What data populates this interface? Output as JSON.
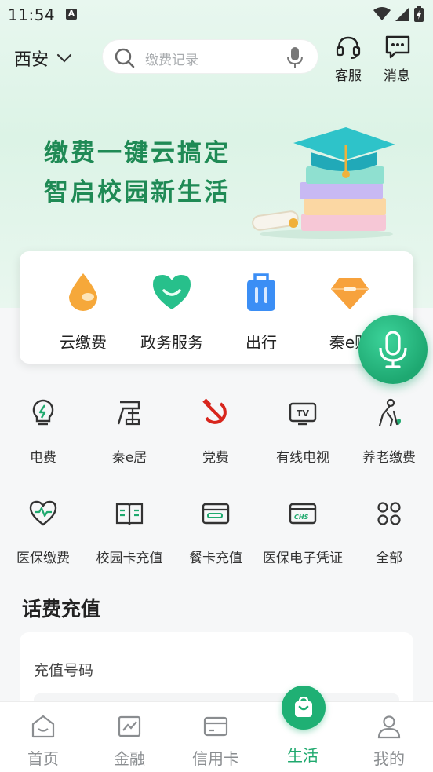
{
  "status_bar": {
    "time": "11:54",
    "a_badge": "A"
  },
  "header": {
    "city": "西安",
    "search_placeholder": "缴费记录",
    "service_label": "客服",
    "message_label": "消息"
  },
  "banner": {
    "line1": "缴费一键云搞定",
    "line2": "智启校园新生活"
  },
  "quick_services": [
    {
      "label": "云缴费",
      "icon": "water-drop-icon",
      "color": "#f6a83a"
    },
    {
      "label": "政务服务",
      "icon": "heart-smile-icon",
      "color": "#27c08b"
    },
    {
      "label": "出行",
      "icon": "luggage-icon",
      "color": "#3b8ef5"
    },
    {
      "label": "秦e购",
      "icon": "diamond-icon",
      "color": "#f7a23c"
    }
  ],
  "grid_row1": [
    {
      "label": "电费",
      "icon": "lightbulb-icon"
    },
    {
      "label": "秦e居",
      "icon": "residence-icon"
    },
    {
      "label": "党费",
      "icon": "hammer-sickle-icon"
    },
    {
      "label": "有线电视",
      "icon": "tv-icon"
    },
    {
      "label": "养老缴费",
      "icon": "elderly-icon"
    }
  ],
  "grid_row2": [
    {
      "label": "医保缴费",
      "icon": "heart-pulse-icon"
    },
    {
      "label": "校园卡充值",
      "icon": "book-card-icon"
    },
    {
      "label": "餐卡充值",
      "icon": "meal-card-icon"
    },
    {
      "label": "医保电子凭证",
      "icon": "chs-card-icon"
    },
    {
      "label": "全部",
      "icon": "all-apps-icon"
    }
  ],
  "recharge": {
    "title": "话费充值",
    "number_label": "充值号码"
  },
  "bottom_nav": [
    {
      "label": "首页",
      "icon": "home-icon"
    },
    {
      "label": "金融",
      "icon": "finance-chart-icon"
    },
    {
      "label": "信用卡",
      "icon": "credit-card-icon"
    },
    {
      "label": "生活",
      "icon": "shopping-bag-icon",
      "active": true
    },
    {
      "label": "我的",
      "icon": "profile-icon"
    }
  ],
  "colors": {
    "accent": "#1fa96e",
    "banner_text": "#1f8a55"
  }
}
